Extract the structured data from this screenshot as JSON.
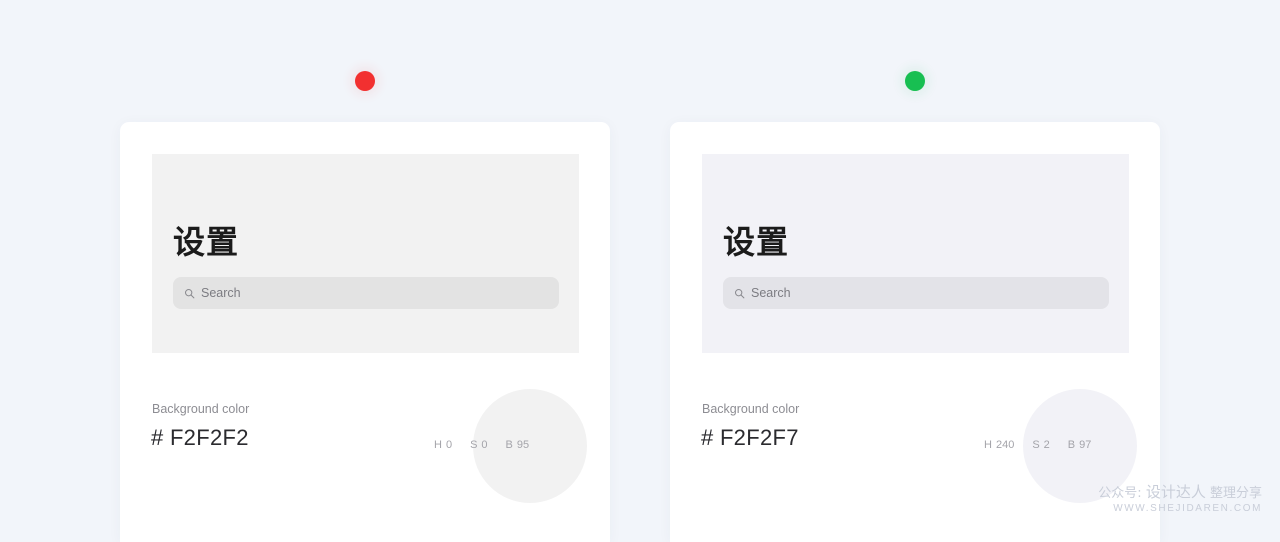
{
  "page": {
    "background_color": "#F2F5FA"
  },
  "markers": [
    {
      "name": "red-dot",
      "color": "#F23030"
    },
    {
      "name": "green-dot",
      "color": "#18BF52"
    }
  ],
  "cards": [
    {
      "preview": {
        "background_color": "#F2F2F2",
        "title": "设置",
        "search": {
          "placeholder": "Search",
          "icon": "search-icon",
          "background_color": "#E3E3E3"
        }
      },
      "info": {
        "label": "Background color",
        "hex": "# F2F2F2",
        "swatch_color": "#F2F2F2",
        "hsb": [
          {
            "key": "H",
            "value": "0"
          },
          {
            "key": "S",
            "value": "0"
          },
          {
            "key": "B",
            "value": "95"
          }
        ]
      }
    },
    {
      "preview": {
        "background_color": "#F2F2F7",
        "title": "设置",
        "search": {
          "placeholder": "Search",
          "icon": "search-icon",
          "background_color": "#E3E3E8"
        }
      },
      "info": {
        "label": "Background color",
        "hex": "# F2F2F7",
        "swatch_color": "#F2F2F7",
        "hsb": [
          {
            "key": "H",
            "value": "240"
          },
          {
            "key": "S",
            "value": "2"
          },
          {
            "key": "B",
            "value": "97"
          }
        ]
      }
    }
  ],
  "watermark": {
    "prefix": "公众号:",
    "brand": "设计达人",
    "suffix": "整理分享",
    "url": "WWW.SHEJIDAREN.COM"
  }
}
